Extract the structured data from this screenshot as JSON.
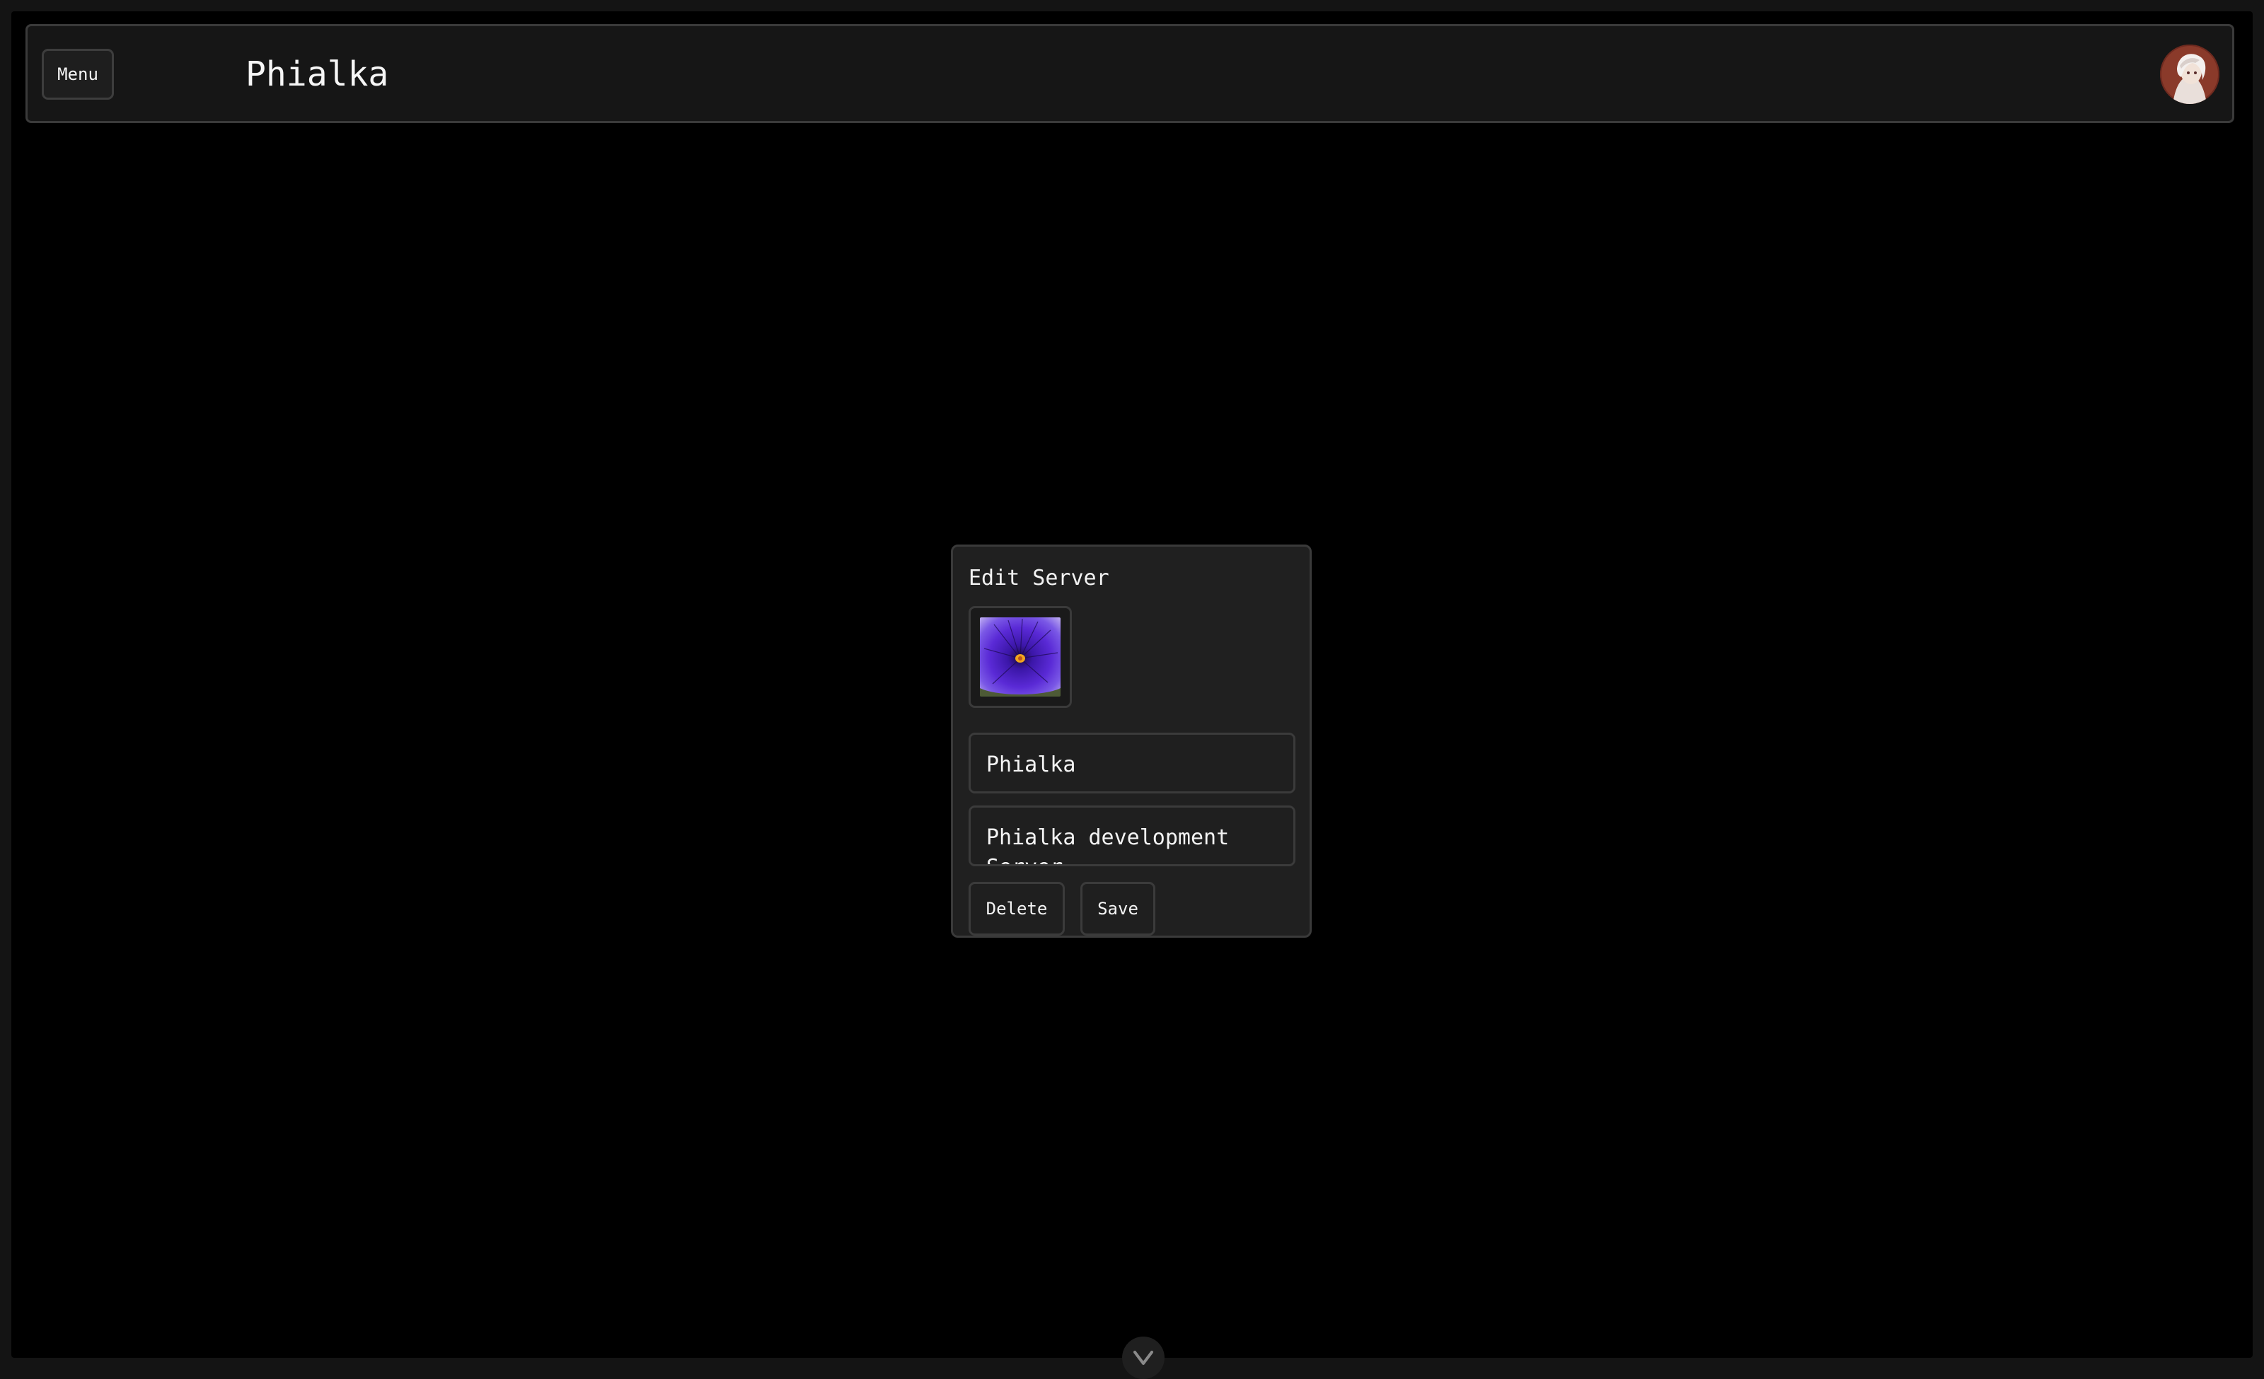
{
  "header": {
    "menu_label": "Menu",
    "title": "Phialka",
    "avatar_icon": "user-avatar"
  },
  "modal": {
    "title": "Edit Server",
    "image_icon": "server-image",
    "name_value": "Phialka",
    "description_value": "Phialka development Server",
    "delete_label": "Delete",
    "save_label": "Save"
  },
  "footer": {
    "scroll_icon": "chevron-down-icon"
  },
  "colors": {
    "background": "#000000",
    "panel": "#202020",
    "border": "#3a3a3a",
    "text": "#f0f0f0"
  }
}
